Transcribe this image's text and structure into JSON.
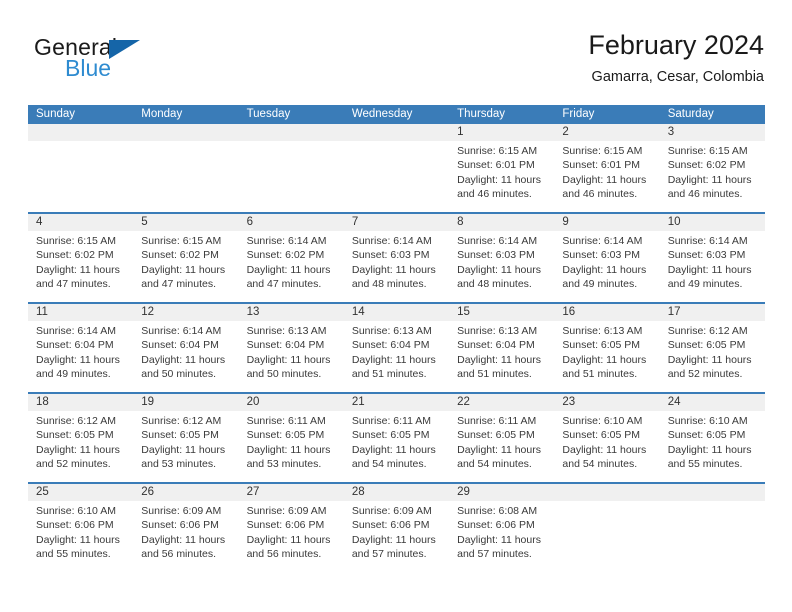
{
  "brand": {
    "name_part1": "General",
    "name_part2": "Blue",
    "triangle_icon": "logo-triangle-icon",
    "color_dark": "#1565a8",
    "color_light": "#2e8bd0"
  },
  "header": {
    "month_title": "February 2024",
    "location": "Gamarra, Cesar, Colombia"
  },
  "theme": {
    "header_blue": "#3a7cb8",
    "date_band_gray": "#f0f0f0",
    "text": "#333333"
  },
  "calendar": {
    "weekdays": [
      "Sunday",
      "Monday",
      "Tuesday",
      "Wednesday",
      "Thursday",
      "Friday",
      "Saturday"
    ],
    "weeks": [
      {
        "days": [
          {
            "date": "",
            "lines": []
          },
          {
            "date": "",
            "lines": []
          },
          {
            "date": "",
            "lines": []
          },
          {
            "date": "",
            "lines": []
          },
          {
            "date": "1",
            "lines": [
              "Sunrise: 6:15 AM",
              "Sunset: 6:01 PM",
              "Daylight: 11 hours",
              "and 46 minutes."
            ]
          },
          {
            "date": "2",
            "lines": [
              "Sunrise: 6:15 AM",
              "Sunset: 6:01 PM",
              "Daylight: 11 hours",
              "and 46 minutes."
            ]
          },
          {
            "date": "3",
            "lines": [
              "Sunrise: 6:15 AM",
              "Sunset: 6:02 PM",
              "Daylight: 11 hours",
              "and 46 minutes."
            ]
          }
        ]
      },
      {
        "days": [
          {
            "date": "4",
            "lines": [
              "Sunrise: 6:15 AM",
              "Sunset: 6:02 PM",
              "Daylight: 11 hours",
              "and 47 minutes."
            ]
          },
          {
            "date": "5",
            "lines": [
              "Sunrise: 6:15 AM",
              "Sunset: 6:02 PM",
              "Daylight: 11 hours",
              "and 47 minutes."
            ]
          },
          {
            "date": "6",
            "lines": [
              "Sunrise: 6:14 AM",
              "Sunset: 6:02 PM",
              "Daylight: 11 hours",
              "and 47 minutes."
            ]
          },
          {
            "date": "7",
            "lines": [
              "Sunrise: 6:14 AM",
              "Sunset: 6:03 PM",
              "Daylight: 11 hours",
              "and 48 minutes."
            ]
          },
          {
            "date": "8",
            "lines": [
              "Sunrise: 6:14 AM",
              "Sunset: 6:03 PM",
              "Daylight: 11 hours",
              "and 48 minutes."
            ]
          },
          {
            "date": "9",
            "lines": [
              "Sunrise: 6:14 AM",
              "Sunset: 6:03 PM",
              "Daylight: 11 hours",
              "and 49 minutes."
            ]
          },
          {
            "date": "10",
            "lines": [
              "Sunrise: 6:14 AM",
              "Sunset: 6:03 PM",
              "Daylight: 11 hours",
              "and 49 minutes."
            ]
          }
        ]
      },
      {
        "days": [
          {
            "date": "11",
            "lines": [
              "Sunrise: 6:14 AM",
              "Sunset: 6:04 PM",
              "Daylight: 11 hours",
              "and 49 minutes."
            ]
          },
          {
            "date": "12",
            "lines": [
              "Sunrise: 6:14 AM",
              "Sunset: 6:04 PM",
              "Daylight: 11 hours",
              "and 50 minutes."
            ]
          },
          {
            "date": "13",
            "lines": [
              "Sunrise: 6:13 AM",
              "Sunset: 6:04 PM",
              "Daylight: 11 hours",
              "and 50 minutes."
            ]
          },
          {
            "date": "14",
            "lines": [
              "Sunrise: 6:13 AM",
              "Sunset: 6:04 PM",
              "Daylight: 11 hours",
              "and 51 minutes."
            ]
          },
          {
            "date": "15",
            "lines": [
              "Sunrise: 6:13 AM",
              "Sunset: 6:04 PM",
              "Daylight: 11 hours",
              "and 51 minutes."
            ]
          },
          {
            "date": "16",
            "lines": [
              "Sunrise: 6:13 AM",
              "Sunset: 6:05 PM",
              "Daylight: 11 hours",
              "and 51 minutes."
            ]
          },
          {
            "date": "17",
            "lines": [
              "Sunrise: 6:12 AM",
              "Sunset: 6:05 PM",
              "Daylight: 11 hours",
              "and 52 minutes."
            ]
          }
        ]
      },
      {
        "days": [
          {
            "date": "18",
            "lines": [
              "Sunrise: 6:12 AM",
              "Sunset: 6:05 PM",
              "Daylight: 11 hours",
              "and 52 minutes."
            ]
          },
          {
            "date": "19",
            "lines": [
              "Sunrise: 6:12 AM",
              "Sunset: 6:05 PM",
              "Daylight: 11 hours",
              "and 53 minutes."
            ]
          },
          {
            "date": "20",
            "lines": [
              "Sunrise: 6:11 AM",
              "Sunset: 6:05 PM",
              "Daylight: 11 hours",
              "and 53 minutes."
            ]
          },
          {
            "date": "21",
            "lines": [
              "Sunrise: 6:11 AM",
              "Sunset: 6:05 PM",
              "Daylight: 11 hours",
              "and 54 minutes."
            ]
          },
          {
            "date": "22",
            "lines": [
              "Sunrise: 6:11 AM",
              "Sunset: 6:05 PM",
              "Daylight: 11 hours",
              "and 54 minutes."
            ]
          },
          {
            "date": "23",
            "lines": [
              "Sunrise: 6:10 AM",
              "Sunset: 6:05 PM",
              "Daylight: 11 hours",
              "and 54 minutes."
            ]
          },
          {
            "date": "24",
            "lines": [
              "Sunrise: 6:10 AM",
              "Sunset: 6:05 PM",
              "Daylight: 11 hours",
              "and 55 minutes."
            ]
          }
        ]
      },
      {
        "days": [
          {
            "date": "25",
            "lines": [
              "Sunrise: 6:10 AM",
              "Sunset: 6:06 PM",
              "Daylight: 11 hours",
              "and 55 minutes."
            ]
          },
          {
            "date": "26",
            "lines": [
              "Sunrise: 6:09 AM",
              "Sunset: 6:06 PM",
              "Daylight: 11 hours",
              "and 56 minutes."
            ]
          },
          {
            "date": "27",
            "lines": [
              "Sunrise: 6:09 AM",
              "Sunset: 6:06 PM",
              "Daylight: 11 hours",
              "and 56 minutes."
            ]
          },
          {
            "date": "28",
            "lines": [
              "Sunrise: 6:09 AM",
              "Sunset: 6:06 PM",
              "Daylight: 11 hours",
              "and 57 minutes."
            ]
          },
          {
            "date": "29",
            "lines": [
              "Sunrise: 6:08 AM",
              "Sunset: 6:06 PM",
              "Daylight: 11 hours",
              "and 57 minutes."
            ]
          },
          {
            "date": "",
            "lines": []
          },
          {
            "date": "",
            "lines": []
          }
        ]
      }
    ]
  }
}
